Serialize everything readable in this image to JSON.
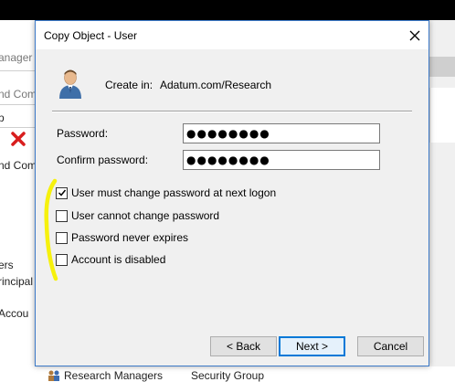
{
  "background_window": {
    "fragments": [
      "anager",
      "nd Com",
      "p",
      "nd Com",
      "ers",
      "rincipal",
      "Accou"
    ],
    "bottom_row": {
      "name": "Research Managers",
      "type": "Security Group"
    }
  },
  "dialog": {
    "title": "Copy Object - User",
    "close_icon": "close-icon",
    "create_in_label": "Create in:",
    "create_in_path": "Adatum.com/Research",
    "password_label": "Password:",
    "password_value": "●●●●●●●●",
    "confirm_label": "Confirm password:",
    "confirm_value": "●●●●●●●●",
    "options": [
      {
        "label": "User must change password at next logon",
        "checked": true
      },
      {
        "label": "User cannot change password",
        "checked": false
      },
      {
        "label": "Password never expires",
        "checked": false
      },
      {
        "label": "Account is disabled",
        "checked": false
      }
    ],
    "buttons": {
      "back": "< Back",
      "next": "Next >",
      "cancel": "Cancel"
    }
  },
  "colors": {
    "dialog_border": "#3c79c8",
    "primary_button_border": "#0078d7",
    "annotation_highlight": "#f5f000"
  }
}
